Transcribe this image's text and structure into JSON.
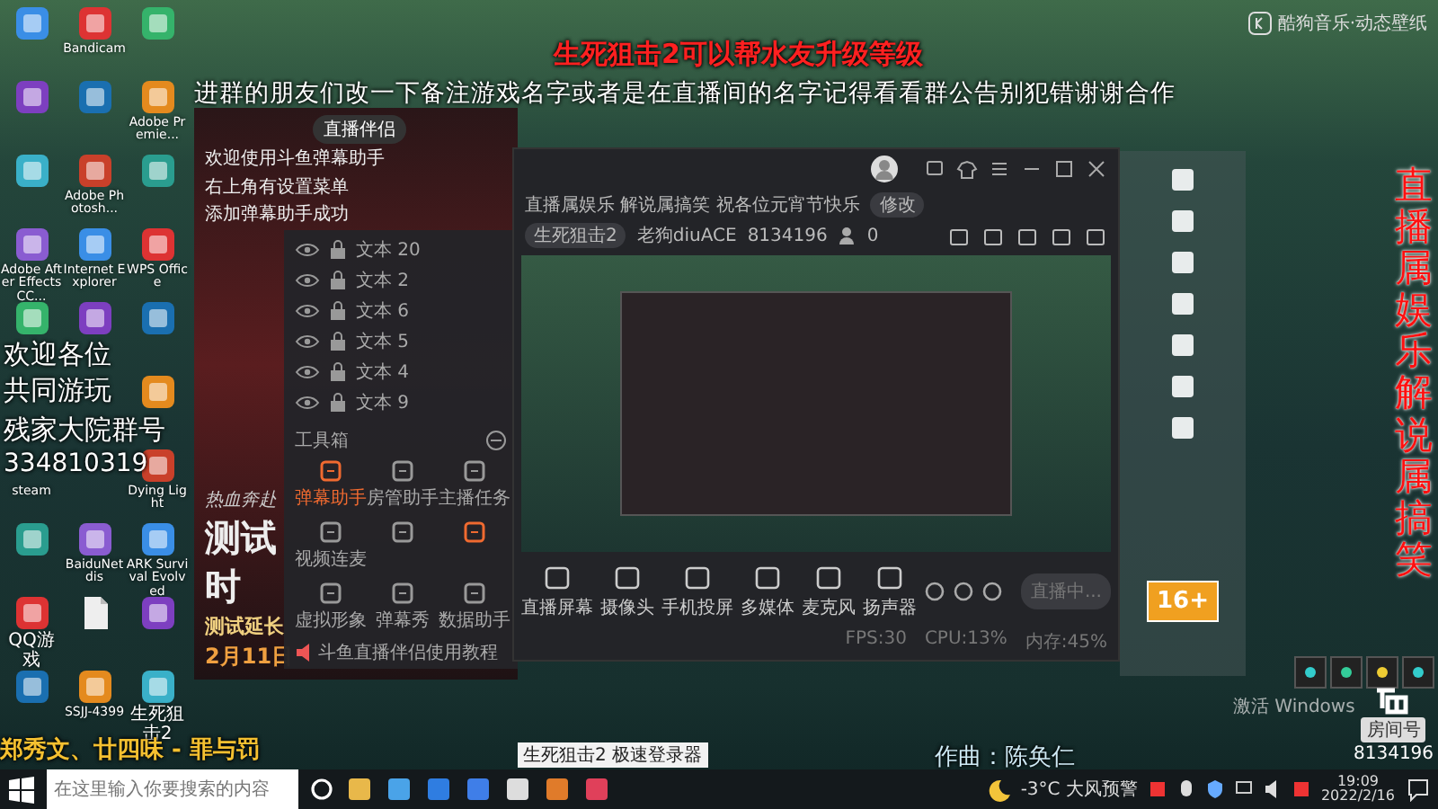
{
  "wallpaper_credit": "酷狗音乐·动态壁纸",
  "desktop_icon_rows": [
    [
      {
        "kind": "app"
      },
      {
        "kind": "app",
        "label": "Bandicam"
      },
      {
        "kind": "app"
      }
    ],
    [
      {
        "kind": "app"
      },
      {
        "kind": "app"
      },
      {
        "kind": "app",
        "label": "Adobe Premie..."
      }
    ],
    [
      {
        "kind": "app"
      },
      {
        "kind": "app",
        "label": "Adobe Photosh..."
      },
      {
        "kind": "app"
      }
    ],
    [
      {
        "kind": "app",
        "label": "Adobe After Effects CC..."
      },
      {
        "kind": "app",
        "label": "Internet Explorer"
      },
      {
        "kind": "app",
        "label": "WPS Office"
      }
    ],
    [
      {
        "kind": "app"
      },
      {
        "kind": "app"
      },
      {
        "kind": "app"
      }
    ],
    [
      {
        "kind": "app"
      }
    ],
    [
      {
        "kind": "label",
        "label": "steam"
      },
      {
        "kind": "app",
        "label": "Dying Light"
      }
    ],
    [
      {
        "kind": "app"
      },
      {
        "kind": "app",
        "label": "BaiduNetdis"
      },
      {
        "kind": "app",
        "label": "ARK Survival Evolved"
      }
    ],
    [
      {
        "kind": "app",
        "label": "QQ游戏"
      },
      {
        "kind": "file"
      },
      {
        "kind": "app"
      }
    ],
    [
      {
        "kind": "app"
      },
      {
        "kind": "app",
        "label": "SSJJ-4399"
      },
      {
        "kind": "app",
        "label": "生死狙击2"
      }
    ]
  ],
  "overlays": {
    "welcome": [
      "欢迎各位",
      "共同游玩"
    ],
    "group_label": "残家大院群号",
    "group_number": "334810319",
    "song": "郑秀文、廿四味 - 罪与罚",
    "headline": "生死狙击2可以帮水友升级等级",
    "notice": "进群的朋友们改一下备注游戏名字或者是在直播间的名字记得看看群公告别犯错谢谢合作",
    "vertical_slogan": "直播属娱乐解说属搞笑",
    "composer": "作曲：陈奂仁"
  },
  "launcher": {
    "title": "直播伴侣",
    "intro": [
      "欢迎使用斗鱼弹幕助手",
      "右上角有设置菜单",
      "添加弹幕助手成功"
    ],
    "banner": [
      "热血奔赴",
      "测试时",
      "测试延长",
      "2月11日"
    ]
  },
  "danmaku_panel": {
    "layers": [
      {
        "label": "文本 20"
      },
      {
        "label": "文本 2"
      },
      {
        "label": "文本 6"
      },
      {
        "label": "文本 5"
      },
      {
        "label": "文本 4"
      },
      {
        "label": "文本 9"
      }
    ],
    "section": "工具箱",
    "tools": [
      {
        "label": "弹幕助手",
        "active": true
      },
      {
        "label": "房管助手",
        "active": false
      },
      {
        "label": "主播任务",
        "active": false
      },
      {
        "label": "视频连麦",
        "active": false
      },
      {
        "active": false
      },
      {
        "active": true
      },
      {
        "label": "虚拟形象",
        "active": false
      },
      {
        "label": "弹幕秀",
        "active": false
      },
      {
        "label": "数据助手",
        "active": false
      }
    ],
    "footer": "斗鱼直播伴侣使用教程"
  },
  "stream_app": {
    "title": "直播属娱乐 解说属搞笑 祝各位元宵节快乐",
    "edit": "修改",
    "category": "生死狙击2",
    "streamer": "老狗diuACE",
    "room": "8134196",
    "viewers": "0",
    "controls": [
      {
        "label": "直播屏幕"
      },
      {
        "label": "摄像头"
      },
      {
        "label": "手机投屏"
      },
      {
        "label": "多媒体"
      },
      {
        "label": "麦克风"
      },
      {
        "label": "扬声器"
      }
    ],
    "live_button": "直播中...",
    "stats": [
      "FPS:30",
      "CPU:13%",
      "内存:45%"
    ]
  },
  "age_badge": "16+",
  "douyu": {
    "room_label": "房间号",
    "room": "8134196"
  },
  "windows_watermark": "激活 Windows",
  "taskbar": {
    "search_placeholder": "在这里输入你要搜索的内容",
    "tooltip": "生死狙击2 极速登录器",
    "weather": "-3°C 大风预警",
    "time": "19:09",
    "date": "2022/2/16"
  }
}
